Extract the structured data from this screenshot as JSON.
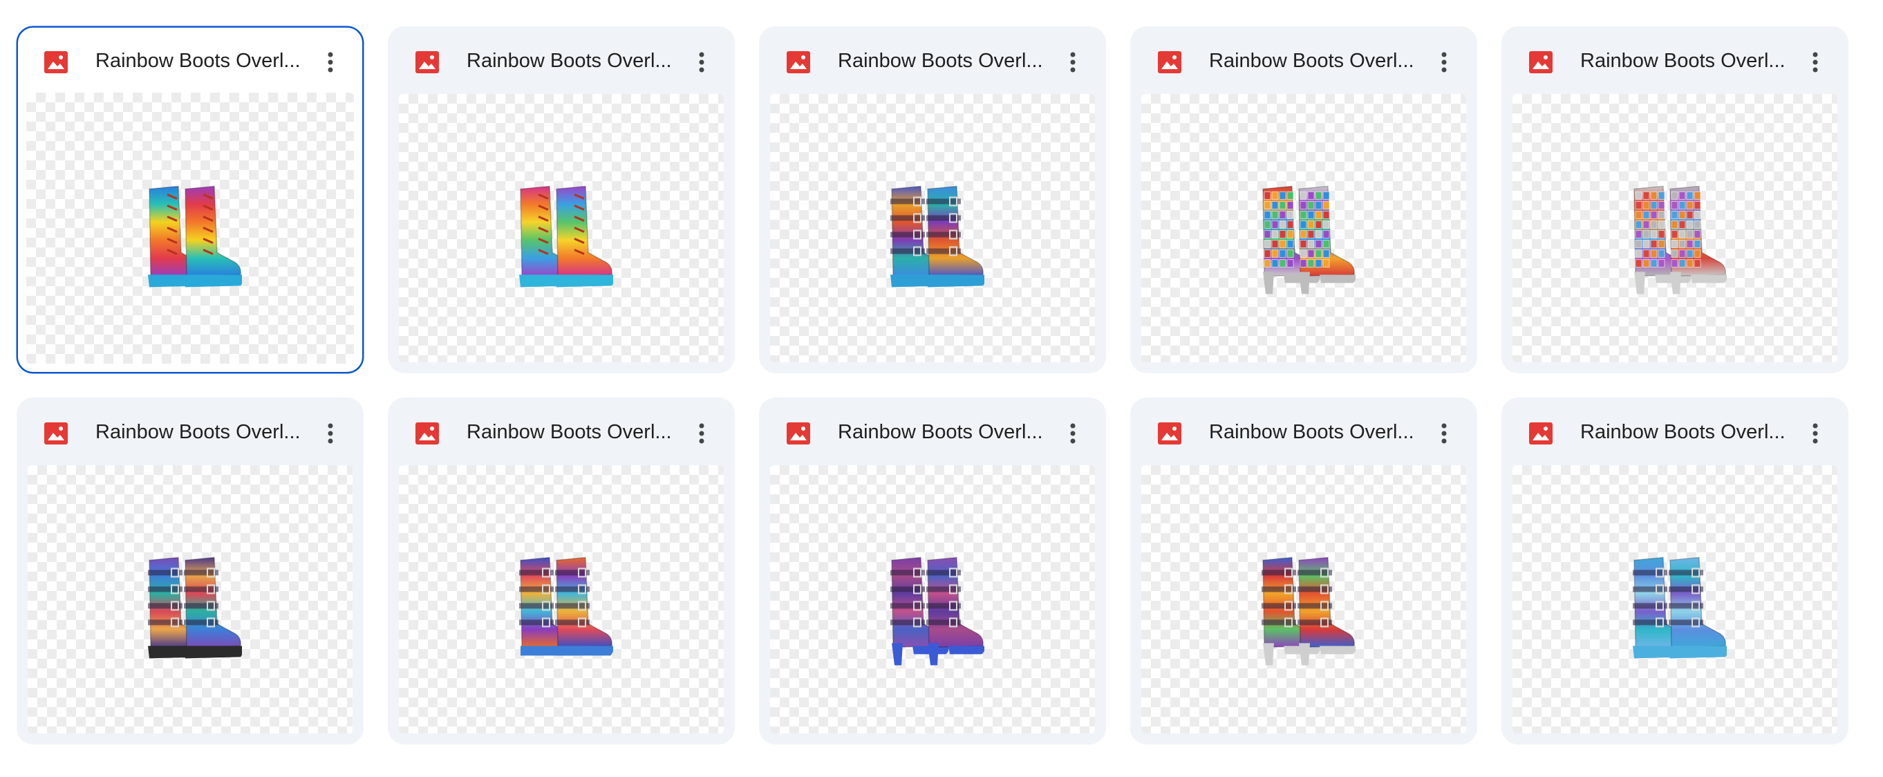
{
  "colors": {
    "card_bg": "#f0f4f9",
    "selected_border": "#0b57d0",
    "image_icon": "#e53935",
    "title_text": "#1f1f1f"
  },
  "files": [
    {
      "title": "Rainbow Boots Overl...",
      "icon": "image-file-icon",
      "selected": true,
      "boot": {
        "style": "lace",
        "heel": "platform",
        "colors": [
          "#2a7de1",
          "#27c0b5",
          "#f4d21f",
          "#f2782a",
          "#e23b4b",
          "#9b3dbd"
        ],
        "sole": "#28a9d9"
      }
    },
    {
      "title": "Rainbow Boots Overl...",
      "icon": "image-file-icon",
      "selected": false,
      "boot": {
        "style": "lace",
        "heel": "platform",
        "colors": [
          "#d6338a",
          "#f27a2a",
          "#f5d42a",
          "#57c46b",
          "#3aa0e3",
          "#9b45c9"
        ],
        "sole": "#2fb4dc"
      }
    },
    {
      "title": "Rainbow Boots Overl...",
      "icon": "image-file-icon",
      "selected": false,
      "boot": {
        "style": "buckle",
        "heel": "platform",
        "colors": [
          "#4c56c9",
          "#e9a02b",
          "#e0572e",
          "#7e3db5",
          "#2bb0a9",
          "#3c8be0"
        ],
        "sole": "#2d9fd6"
      }
    },
    {
      "title": "Rainbow Boots Overl...",
      "icon": "image-file-icon",
      "selected": false,
      "boot": {
        "style": "sequin",
        "heel": "high",
        "colors": [
          "#d63a3a",
          "#f3a22a",
          "#2d8fe0",
          "#4bbf6a",
          "#9a4ac9",
          "#c9c9c9"
        ],
        "sole": "#bdbdbd"
      }
    },
    {
      "title": "Rainbow Boots Overl...",
      "icon": "image-file-icon",
      "selected": false,
      "boot": {
        "style": "sequin",
        "heel": "high",
        "colors": [
          "#c9c9c9",
          "#d8463d",
          "#e98a2e",
          "#4da0de",
          "#a957c4",
          "#b5b5b5"
        ],
        "sole": "#cfcfcf"
      }
    },
    {
      "title": "Rainbow Boots Overl...",
      "icon": "image-file-icon",
      "selected": false,
      "boot": {
        "style": "buckle",
        "heel": "platform",
        "colors": [
          "#7b4bb8",
          "#3d7fd8",
          "#2bb0a0",
          "#d94a58",
          "#e9a54a",
          "#4b3a8c"
        ],
        "sole": "#2b2b2b"
      }
    },
    {
      "title": "Rainbow Boots Overl...",
      "icon": "image-file-icon",
      "selected": false,
      "boot": {
        "style": "buckle",
        "heel": "flat",
        "colors": [
          "#3d4fc4",
          "#e04a5a",
          "#ecb23a",
          "#43b6d8",
          "#8a3dbd",
          "#e86a2b"
        ],
        "sole": "#3d7fd8"
      }
    },
    {
      "title": "Rainbow Boots Overl...",
      "icon": "image-file-icon",
      "selected": false,
      "boot": {
        "style": "buckle",
        "heel": "high",
        "colors": [
          "#7a3fa8",
          "#a84b8a",
          "#5e3c9e",
          "#c2508a",
          "#4a62c4",
          "#8b4fb0"
        ],
        "sole": "#3b5bd6"
      }
    },
    {
      "title": "Rainbow Boots Overl...",
      "icon": "image-file-icon",
      "selected": false,
      "boot": {
        "style": "buckle",
        "heel": "high",
        "colors": [
          "#3a5fd1",
          "#d93a3a",
          "#f0a32a",
          "#e5542e",
          "#5bc065",
          "#8e45c0"
        ],
        "sole": "#cfcfcf"
      }
    },
    {
      "title": "Rainbow Boots Overl...",
      "icon": "image-file-icon",
      "selected": false,
      "boot": {
        "style": "buckle",
        "heel": "platform",
        "colors": [
          "#3fa7d8",
          "#5b8fe0",
          "#8fd3e8",
          "#7a5fc9",
          "#2fb7c8",
          "#6fb5e8"
        ],
        "sole": "#4cb0de"
      }
    }
  ]
}
